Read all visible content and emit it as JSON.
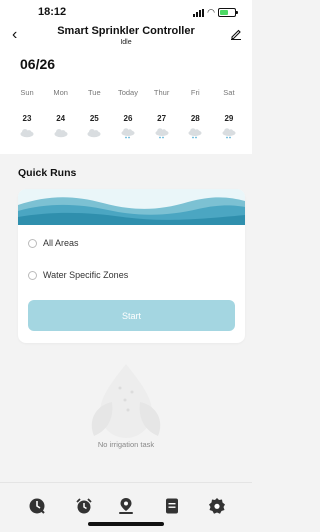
{
  "status_bar": {
    "time": "18:12"
  },
  "header": {
    "title": "Smart Sprinkler Controller",
    "subtitle": "Idle"
  },
  "date_heading": "06/26",
  "forecast": [
    {
      "day": "Sun",
      "date": "23",
      "weather": "cloud-icon"
    },
    {
      "day": "Mon",
      "date": "24",
      "weather": "cloud-icon"
    },
    {
      "day": "Tue",
      "date": "25",
      "weather": "cloud-icon"
    },
    {
      "day": "Today",
      "date": "26",
      "weather": "rain-cloud-icon"
    },
    {
      "day": "Thur",
      "date": "27",
      "weather": "rain-cloud-icon"
    },
    {
      "day": "Fri",
      "date": "28",
      "weather": "rain-cloud-icon"
    },
    {
      "day": "Sat",
      "date": "29",
      "weather": "rain-cloud-icon"
    }
  ],
  "quick_runs": {
    "title": "Quick Runs",
    "options": [
      "All Areas",
      "Water Specific Zones"
    ],
    "start_label": "Start"
  },
  "empty_state": {
    "text": "No irrigation task"
  },
  "tab_bar": {
    "items": [
      "history-icon",
      "alarm-clock-icon",
      "zone-location-icon",
      "schedule-list-icon",
      "settings-gear-icon"
    ]
  },
  "colors": {
    "accent": "#a4d6e1",
    "wave_dark": "#2f8fad",
    "wave_light": "#7cc1d3",
    "background": "#f3f3f3"
  }
}
